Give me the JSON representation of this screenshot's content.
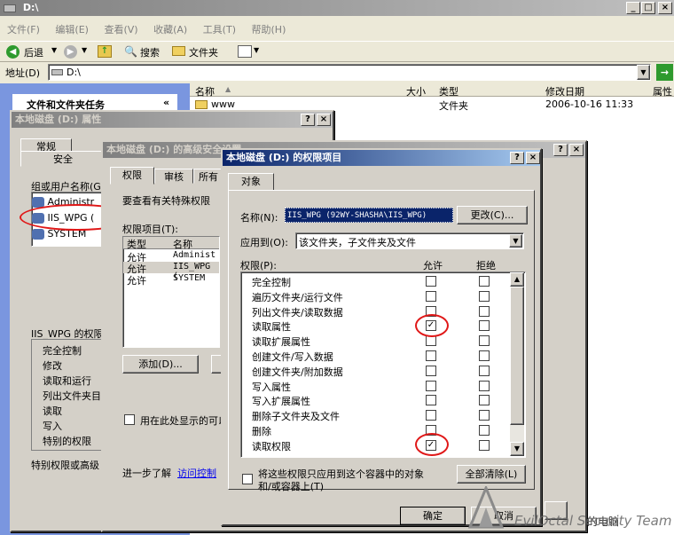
{
  "explorer": {
    "title": "D:\\",
    "menu": [
      "文件(F)",
      "编辑(E)",
      "查看(V)",
      "收藏(A)",
      "工具(T)",
      "帮助(H)"
    ],
    "back_label": "后退",
    "search_label": "搜索",
    "folders_label": "文件夹",
    "address_label": "地址(D)",
    "address_value": "D:\\",
    "tasks_header": "文件和文件夹任务",
    "columns": [
      "名称",
      "大小",
      "类型",
      "修改日期",
      "属性"
    ],
    "row": {
      "name": "www",
      "type": "文件夹",
      "date": "2006-10-16 11:33"
    }
  },
  "props_dialog": {
    "title": "本地磁盘 (D:) 属性",
    "tab_general": "常规",
    "tab_security": "安全",
    "group_label": "组或用户名称(G):",
    "users": [
      "Administr",
      "IIS_WPG (",
      "SYSTEM"
    ],
    "perm_for": "IIS_WPG 的权限",
    "perms": [
      "完全控制",
      "修改",
      "读取和运行",
      "列出文件夹目",
      "读取",
      "写入",
      "特别的权限"
    ],
    "special_text": "特别权限或高级"
  },
  "adv_dialog": {
    "title": "本地磁盘 (D:) 的高级安全设置",
    "tabs": [
      "权限",
      "审核",
      "所有"
    ],
    "desc": "要查看有关特殊权限",
    "entries_label": "权限项目(T):",
    "col_type": "类型",
    "col_name": "名称",
    "rows": [
      {
        "type": "允许",
        "name": "Administ"
      },
      {
        "type": "允许",
        "name": "IIS_WPG ("
      },
      {
        "type": "允许",
        "name": "SYSTEM"
      }
    ],
    "add_button": "添加(D)...",
    "inherit_text": "用在此处显示的可以",
    "more_text": "进一步了解",
    "more_link": "访问控制"
  },
  "entry_dialog": {
    "title": "本地磁盘 (D:) 的权限项目",
    "tab_object": "对象",
    "name_label": "名称(N):",
    "name_value": "IIS_WPG (92WY-SHASHA\\IIS_WPG)",
    "change_button": "更改(C)...",
    "apply_label": "应用到(O):",
    "apply_value": "该文件夹，子文件夹及文件",
    "perm_label": "权限(P):",
    "allow_header": "允许",
    "deny_header": "拒绝",
    "permissions": [
      {
        "label": "完全控制",
        "allow": false,
        "deny": false
      },
      {
        "label": "遍历文件夹/运行文件",
        "allow": false,
        "deny": false
      },
      {
        "label": "列出文件夹/读取数据",
        "allow": false,
        "deny": false
      },
      {
        "label": "读取属性",
        "allow": true,
        "deny": false
      },
      {
        "label": "读取扩展属性",
        "allow": false,
        "deny": false
      },
      {
        "label": "创建文件/写入数据",
        "allow": false,
        "deny": false
      },
      {
        "label": "创建文件夹/附加数据",
        "allow": false,
        "deny": false
      },
      {
        "label": "写入属性",
        "allow": false,
        "deny": false
      },
      {
        "label": "写入扩展属性",
        "allow": false,
        "deny": false
      },
      {
        "label": "删除子文件夹及文件",
        "allow": false,
        "deny": false
      },
      {
        "label": "删除",
        "allow": false,
        "deny": false
      },
      {
        "label": "读取权限",
        "allow": true,
        "deny": false
      }
    ],
    "apply_only_line1": "将这些权限只应用到这个容器中的对象",
    "apply_only_line2": "和/或容器上(T)",
    "clear_all_button": "全部清除(L)",
    "ok_button": "确定",
    "cancel_button": "取消"
  },
  "watermark": "EvilOctal Security Team",
  "watermark_partial": "的电脑"
}
